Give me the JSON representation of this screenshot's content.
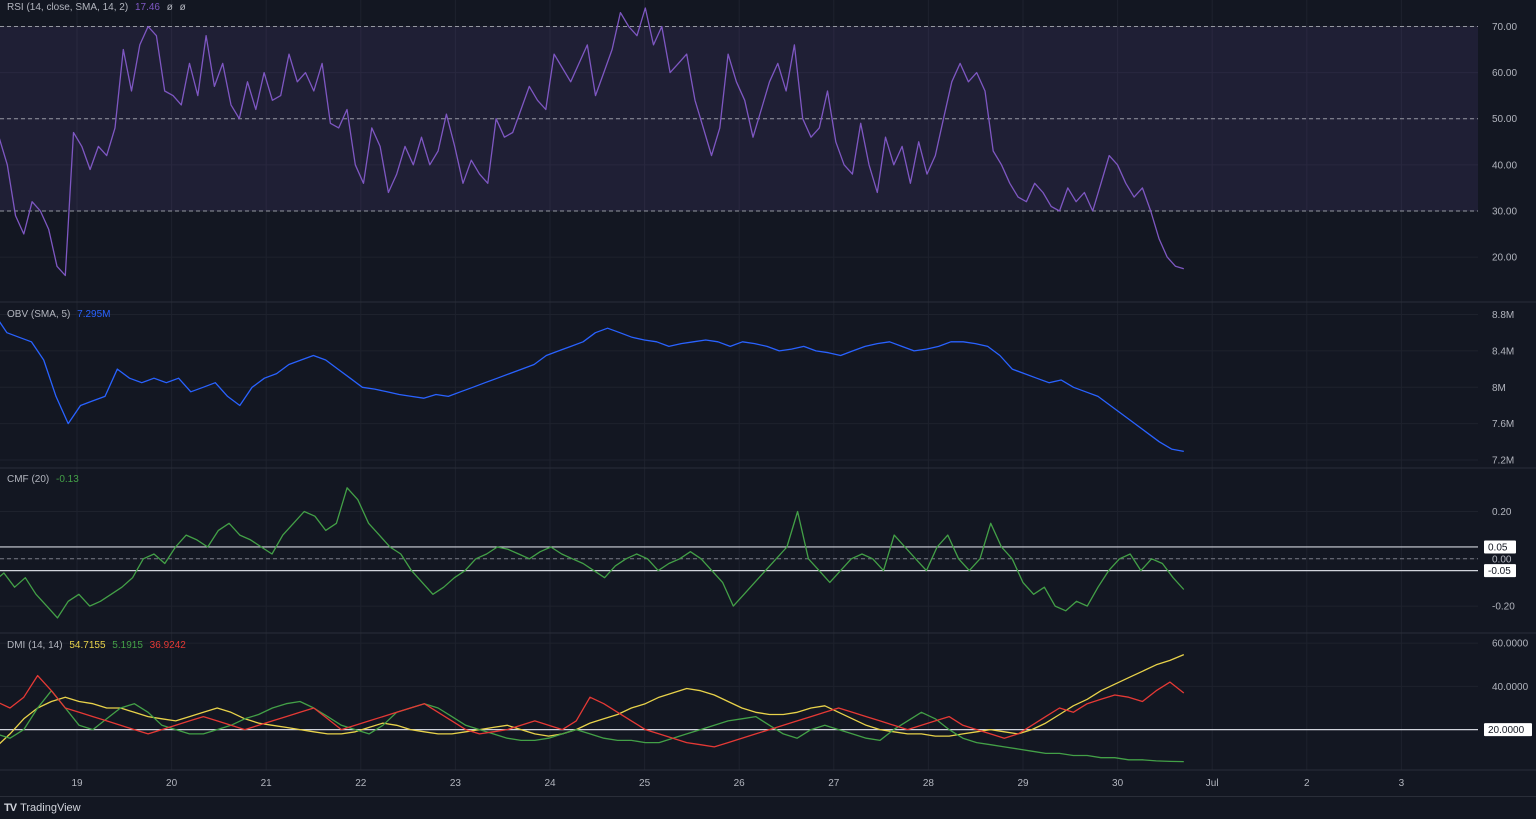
{
  "colors": {
    "background": "#131722",
    "grid": "#1e222d",
    "axis_text": "#b2b5be",
    "rsi": "#7e57c2",
    "rsi_band": "#7e57c2",
    "obv": "#2962ff",
    "cmf": "#43a047",
    "dmi_adx": "#e8d24a",
    "dmi_plus": "#43a047",
    "dmi_minus": "#e53935"
  },
  "brand": {
    "icon": "TV",
    "name": "TradingView"
  },
  "x_axis": {
    "labels": [
      "19",
      "20",
      "21",
      "22",
      "23",
      "24",
      "25",
      "26",
      "27",
      "28",
      "29",
      "30",
      "Jul",
      "2",
      "3"
    ]
  },
  "panes": {
    "rsi": {
      "title": "RSI (14, close, SMA, 14, 2)",
      "value": "17.46",
      "extra1": "ø",
      "extra2": "ø"
    },
    "obv": {
      "title": "OBV (SMA, 5)",
      "value": "7.295M"
    },
    "cmf": {
      "title": "CMF (20)",
      "value": "-0.13"
    },
    "dmi": {
      "title": "DMI (14, 14)",
      "adx": "54.7155",
      "plus": "5.1915",
      "minus": "36.9242"
    }
  },
  "chart_data": [
    {
      "type": "line",
      "name": "RSI",
      "ylim": [
        12,
        74
      ],
      "ticks": [
        "70.00",
        "60.00",
        "50.00",
        "40.00",
        "30.00",
        "20.00"
      ],
      "tick_values": [
        70,
        60,
        50,
        40,
        30,
        20
      ],
      "levels": [
        70,
        50,
        30
      ],
      "band": [
        30,
        70
      ],
      "x_start": 18.0,
      "x_end": 30.7,
      "series": [
        {
          "values": [
            48,
            44,
            46,
            40,
            29,
            25,
            32,
            30,
            26,
            18,
            16,
            47,
            44,
            39,
            44,
            42,
            48,
            65,
            56,
            66,
            70,
            68,
            56,
            55,
            53,
            62,
            55,
            68,
            57,
            62,
            53,
            50,
            58,
            52,
            60,
            54,
            55,
            64,
            58,
            60,
            56,
            62,
            49,
            48,
            52,
            40,
            36,
            48,
            44,
            34,
            38,
            44,
            40,
            46,
            40,
            43,
            51,
            44,
            36,
            41,
            38,
            36,
            50,
            46,
            47,
            52,
            57,
            54,
            52,
            64,
            61,
            58,
            62,
            66,
            55,
            60,
            65,
            73,
            70,
            68,
            74,
            66,
            70,
            60,
            62,
            64,
            54,
            48,
            42,
            48,
            64,
            58,
            54,
            46,
            52,
            58,
            62,
            56,
            66,
            50,
            46,
            48,
            56,
            45,
            40,
            38,
            49,
            40,
            34,
            46,
            40,
            44,
            36,
            45,
            38,
            42,
            50,
            58,
            62,
            58,
            60,
            56,
            43,
            40,
            36,
            33,
            32,
            36,
            34,
            31,
            30,
            35,
            32,
            34,
            30,
            36,
            42,
            40,
            36,
            33,
            35,
            30,
            24,
            20,
            18,
            17.46
          ]
        }
      ]
    },
    {
      "type": "line",
      "name": "OBV",
      "ylim": [
        7.2,
        8.85
      ],
      "ticks": [
        "8.8M",
        "8.4M",
        "8M",
        "7.6M",
        "7.2M"
      ],
      "tick_values": [
        8.8,
        8.4,
        8.0,
        7.6,
        7.2
      ],
      "x_start": 18.0,
      "x_end": 30.7,
      "series": [
        {
          "values": [
            8.8,
            8.8,
            8.6,
            8.55,
            8.5,
            8.3,
            7.9,
            7.6,
            7.8,
            7.85,
            7.9,
            8.2,
            8.1,
            8.05,
            8.1,
            8.05,
            8.1,
            7.95,
            8.0,
            8.05,
            7.9,
            7.8,
            8.0,
            8.1,
            8.15,
            8.25,
            8.3,
            8.35,
            8.3,
            8.2,
            8.1,
            8.0,
            7.98,
            7.95,
            7.92,
            7.9,
            7.88,
            7.92,
            7.9,
            7.95,
            8.0,
            8.05,
            8.1,
            8.15,
            8.2,
            8.25,
            8.35,
            8.4,
            8.45,
            8.5,
            8.6,
            8.65,
            8.6,
            8.55,
            8.52,
            8.5,
            8.45,
            8.48,
            8.5,
            8.52,
            8.5,
            8.45,
            8.5,
            8.48,
            8.45,
            8.4,
            8.42,
            8.45,
            8.4,
            8.38,
            8.35,
            8.4,
            8.45,
            8.48,
            8.5,
            8.45,
            8.4,
            8.42,
            8.45,
            8.5,
            8.5,
            8.48,
            8.45,
            8.35,
            8.2,
            8.15,
            8.1,
            8.05,
            8.08,
            8.0,
            7.95,
            7.9,
            7.8,
            7.7,
            7.6,
            7.5,
            7.4,
            7.32,
            7.295
          ]
        }
      ]
    },
    {
      "type": "line",
      "name": "CMF",
      "ylim": [
        -0.28,
        0.35
      ],
      "ticks": [
        "0.20",
        "0.00",
        "-0.20"
      ],
      "tick_values": [
        0.2,
        0.0,
        -0.2
      ],
      "highlight_ticks": [
        "0.05",
        "-0.05"
      ],
      "highlight_values": [
        0.05,
        -0.05
      ],
      "x_start": 18.0,
      "x_end": 30.7,
      "series": [
        {
          "values": [
            -0.05,
            -0.1,
            -0.06,
            -0.12,
            -0.08,
            -0.15,
            -0.2,
            -0.25,
            -0.18,
            -0.15,
            -0.2,
            -0.18,
            -0.15,
            -0.12,
            -0.08,
            0.0,
            0.02,
            -0.02,
            0.05,
            0.1,
            0.08,
            0.05,
            0.12,
            0.15,
            0.1,
            0.08,
            0.05,
            0.02,
            0.1,
            0.15,
            0.2,
            0.18,
            0.12,
            0.15,
            0.3,
            0.25,
            0.15,
            0.1,
            0.05,
            0.02,
            -0.05,
            -0.1,
            -0.15,
            -0.12,
            -0.08,
            -0.05,
            0.0,
            0.02,
            0.05,
            0.04,
            0.02,
            0.0,
            0.03,
            0.05,
            0.02,
            0.0,
            -0.02,
            -0.05,
            -0.08,
            -0.03,
            0.0,
            0.02,
            0.0,
            -0.05,
            -0.02,
            0.0,
            0.03,
            0.0,
            -0.05,
            -0.1,
            -0.2,
            -0.15,
            -0.1,
            -0.05,
            0.0,
            0.05,
            0.2,
            0.0,
            -0.05,
            -0.1,
            -0.05,
            0.0,
            0.02,
            0.0,
            -0.05,
            0.1,
            0.05,
            0.0,
            -0.05,
            0.05,
            0.1,
            0.0,
            -0.05,
            0.0,
            0.15,
            0.05,
            0.0,
            -0.1,
            -0.15,
            -0.12,
            -0.2,
            -0.22,
            -0.18,
            -0.2,
            -0.12,
            -0.05,
            0.0,
            0.02,
            -0.05,
            0.0,
            -0.02,
            -0.08,
            -0.13
          ]
        }
      ]
    },
    {
      "type": "line",
      "name": "DMI",
      "ylim": [
        5,
        61
      ],
      "ticks": [
        "60.0000",
        "40.0000",
        "20.0000"
      ],
      "tick_values": [
        60,
        40,
        20
      ],
      "highlight_ticks": [
        "20.0000"
      ],
      "highlight_values": [
        20
      ],
      "x_start": 18.0,
      "x_end": 30.7,
      "series": [
        {
          "key": "adx",
          "values": [
            13,
            12,
            18,
            25,
            30,
            33,
            35,
            33,
            32,
            30,
            30,
            28,
            26,
            25,
            24,
            26,
            28,
            30,
            28,
            25,
            23,
            22,
            21,
            20,
            19,
            18,
            18,
            19,
            21,
            23,
            22,
            20,
            19,
            18,
            18,
            19,
            20,
            21,
            22,
            20,
            18,
            17,
            18,
            20,
            23,
            25,
            27,
            30,
            32,
            35,
            37,
            39,
            38,
            36,
            33,
            30,
            28,
            27,
            27,
            28,
            30,
            31,
            28,
            25,
            22,
            20,
            19,
            18,
            18,
            17,
            17,
            18,
            19,
            20,
            19,
            18,
            20,
            23,
            27,
            31,
            34,
            38,
            41,
            44,
            47,
            50,
            52,
            54.7155
          ]
        },
        {
          "key": "plus",
          "values": [
            20,
            18,
            16,
            20,
            30,
            38,
            30,
            22,
            20,
            25,
            30,
            32,
            28,
            22,
            20,
            18,
            18,
            20,
            22,
            25,
            27,
            30,
            32,
            33,
            30,
            26,
            22,
            20,
            18,
            22,
            28,
            30,
            32,
            30,
            26,
            22,
            20,
            18,
            16,
            15,
            15,
            16,
            18,
            20,
            18,
            16,
            15,
            15,
            14,
            14,
            16,
            18,
            20,
            22,
            24,
            25,
            26,
            22,
            18,
            16,
            20,
            22,
            20,
            18,
            16,
            15,
            20,
            24,
            28,
            25,
            20,
            16,
            14,
            13,
            12,
            11,
            10,
            9,
            9,
            8,
            8,
            7,
            7,
            6,
            6,
            5.5,
            5.3,
            5.1915
          ]
        },
        {
          "key": "minus",
          "values": [
            28,
            33,
            30,
            35,
            45,
            38,
            30,
            28,
            26,
            24,
            22,
            20,
            18,
            20,
            22,
            24,
            26,
            24,
            22,
            20,
            22,
            24,
            26,
            28,
            30,
            25,
            20,
            22,
            24,
            26,
            28,
            30,
            32,
            28,
            24,
            20,
            18,
            19,
            20,
            22,
            24,
            22,
            20,
            24,
            35,
            32,
            28,
            24,
            20,
            18,
            16,
            14,
            13,
            12,
            14,
            16,
            18,
            20,
            22,
            24,
            26,
            28,
            30,
            28,
            26,
            24,
            22,
            20,
            22,
            24,
            26,
            22,
            20,
            18,
            16,
            18,
            22,
            26,
            30,
            28,
            32,
            34,
            36,
            35,
            33,
            38,
            42,
            36.9242
          ]
        }
      ]
    }
  ]
}
